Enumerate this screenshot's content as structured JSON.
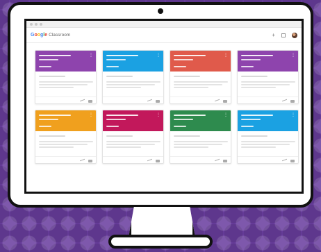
{
  "brand": {
    "google_letters": [
      "G",
      "o",
      "o",
      "g",
      "l",
      "e"
    ],
    "product": "Classroom"
  },
  "header": {
    "actions": [
      "plus-icon",
      "grid-icon",
      "avatar"
    ]
  },
  "colors": {
    "background": "#6b3fa0",
    "purple": "#8e44ad",
    "blue": "#1ba1e2",
    "coral": "#e05a4b",
    "violet": "#8e44ad",
    "amber": "#f0a01e",
    "magenta": "#c2185b",
    "green": "#2e8b4e",
    "sky": "#1ba1e2"
  },
  "cards": [
    {
      "color": "#8e44ad"
    },
    {
      "color": "#1ba1e2"
    },
    {
      "color": "#e05a4b"
    },
    {
      "color": "#8e44ad"
    },
    {
      "color": "#f0a01e"
    },
    {
      "color": "#c2185b"
    },
    {
      "color": "#2e8b4e"
    },
    {
      "color": "#1ba1e2"
    }
  ]
}
